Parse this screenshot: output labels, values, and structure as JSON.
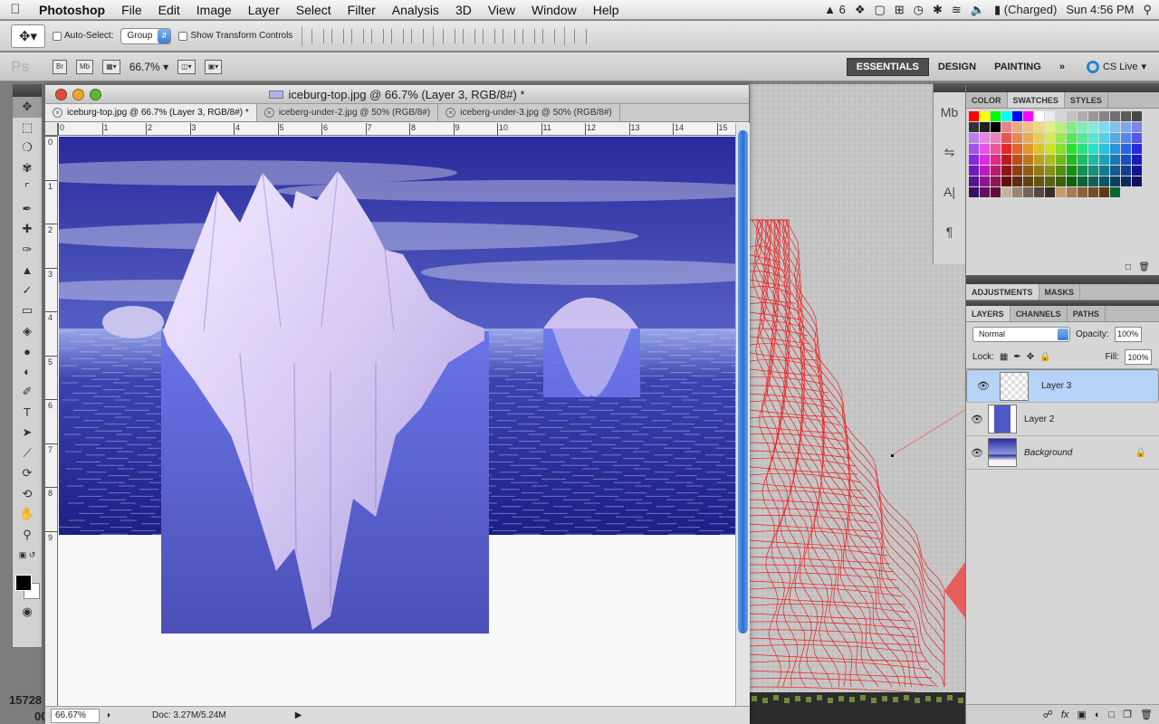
{
  "menubar": {
    "app": "Photoshop",
    "items": [
      "File",
      "Edit",
      "Image",
      "Layer",
      "Select",
      "Filter",
      "Analysis",
      "3D",
      "View",
      "Window",
      "Help"
    ],
    "tray": {
      "adobe_count": "6",
      "battery": "(Charged)",
      "clock": "Sun 4:56 PM"
    }
  },
  "options": {
    "auto_select": "Auto-Select:",
    "group_value": "Group",
    "show_transform": "Show Transform Controls"
  },
  "appbar": {
    "ps": "Ps",
    "br": "Br",
    "mb": "Mb",
    "zoom": "66.7%",
    "workspaces": [
      "ESSENTIALS",
      "DESIGN",
      "PAINTING"
    ],
    "more": "»",
    "cs_live": "CS Live"
  },
  "document": {
    "title": "iceburg-top.jpg @ 66.7% (Layer 3, RGB/8#) *",
    "tabs": [
      {
        "label": "iceburg-top.jpg @ 66.7% (Layer 3, RGB/8#) *"
      },
      {
        "label": "iceberg-under-2.jpg @ 50% (RGB/8#)"
      },
      {
        "label": "iceberg-under-3.jpg @ 50% (RGB/8#)"
      }
    ],
    "ruler_h": [
      "0",
      "1",
      "2",
      "3",
      "4",
      "5",
      "6",
      "7",
      "8",
      "9",
      "10",
      "11",
      "12",
      "13",
      "14",
      "15"
    ],
    "ruler_v": [
      "0",
      "1",
      "2",
      "3",
      "4",
      "5",
      "6",
      "7",
      "8",
      "9"
    ],
    "status_zoom": "66.67%",
    "doc_size": "Doc: 3.27M/5.24M"
  },
  "behind": {
    "left_num_1": "15728",
    "left_num_2": "00"
  },
  "panels": {
    "color_tabs": [
      "COLOR",
      "SWATCHES",
      "STYLES"
    ],
    "adj_tabs": [
      "ADJUSTMENTS",
      "MASKS"
    ],
    "layer_tabs": [
      "LAYERS",
      "CHANNELS",
      "PATHS"
    ],
    "blend_mode": "Normal",
    "opacity_label": "Opacity:",
    "opacity": "100%",
    "lock_label": "Lock:",
    "fill_label": "Fill:",
    "fill": "100%",
    "layers": [
      {
        "name": "Layer 3",
        "selected": true
      },
      {
        "name": "Layer 2",
        "selected": false
      },
      {
        "name": "Background",
        "selected": false
      }
    ]
  },
  "colors": {
    "accent": "#3b7fd6",
    "selected_layer": "#b6d2f7"
  }
}
